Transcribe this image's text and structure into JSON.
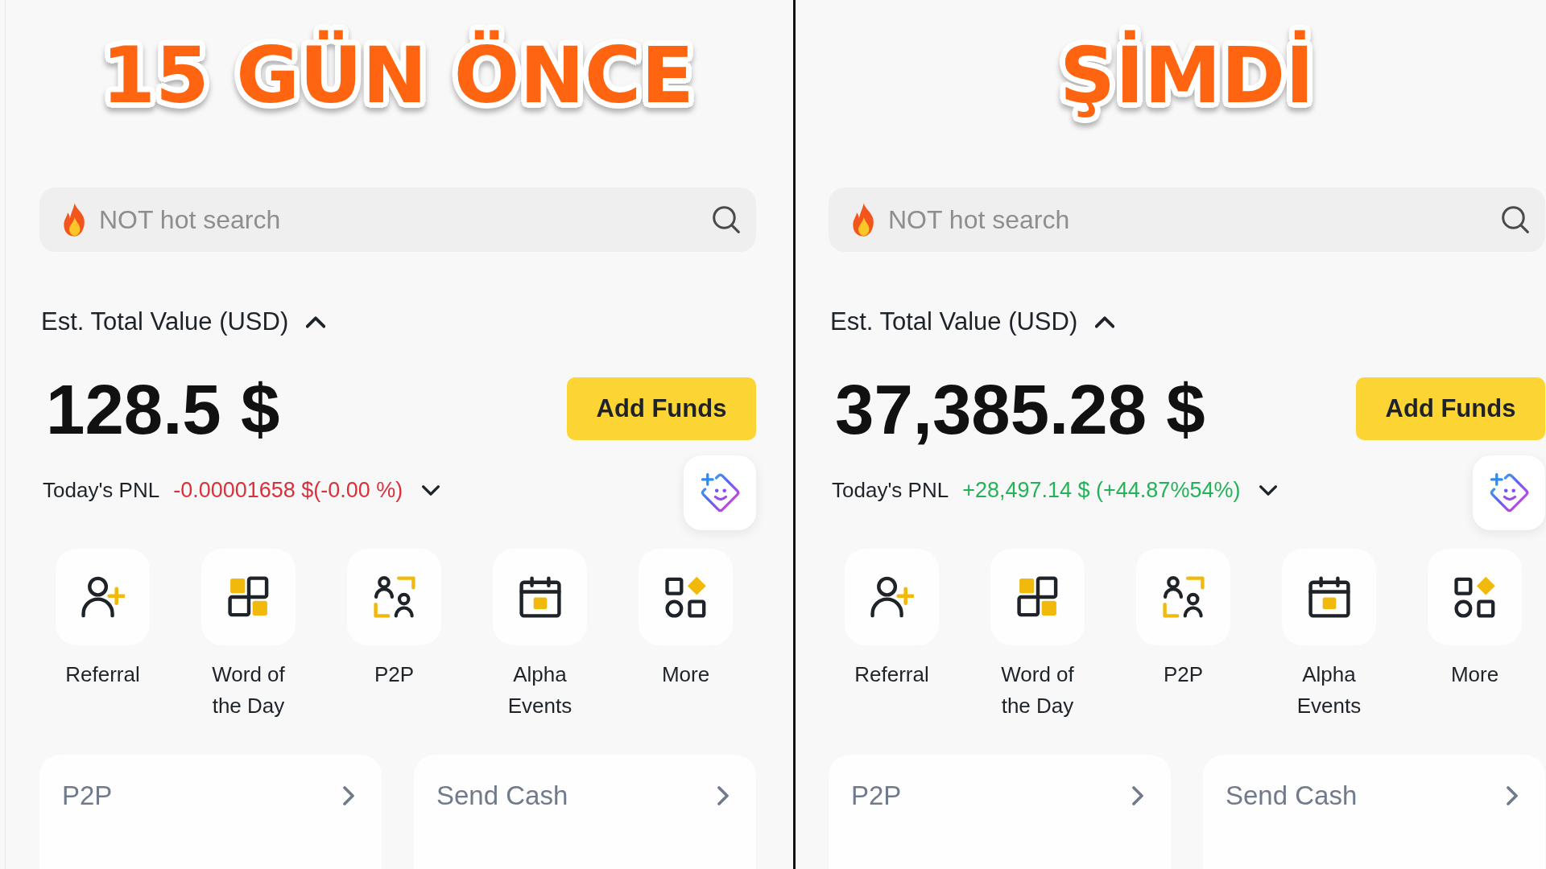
{
  "panels": [
    {
      "headline": "15 GÜN ÖNCE",
      "search": {
        "placeholder": "NOT hot search"
      },
      "balance": {
        "label": "Est. Total Value (USD)",
        "expanded": true,
        "value": "128.5 $",
        "button": "Add Funds"
      },
      "pnl": {
        "label": "Today's PNL",
        "value": "-0.00001658 $(-0.00 %)",
        "color": "#d9303a",
        "expanded": false
      },
      "shortcuts": [
        {
          "kind": "referral",
          "label": "Referral"
        },
        {
          "kind": "word",
          "label": "Word of the Day"
        },
        {
          "kind": "p2p",
          "label": "P2P"
        },
        {
          "kind": "calendar",
          "label": "Alpha Events"
        },
        {
          "kind": "more",
          "label": "More"
        }
      ],
      "cards": [
        "P2P",
        "Send Cash"
      ]
    },
    {
      "headline": "ŞİMDİ",
      "search": {
        "placeholder": "NOT hot search"
      },
      "balance": {
        "label": "Est. Total Value (USD)",
        "expanded": true,
        "value": "37,385.28 $",
        "button": "Add Funds"
      },
      "pnl": {
        "label": "Today's PNL",
        "value": "+28,497.14 $ (+44.87%54%)",
        "color": "#22b357",
        "expanded": false
      },
      "shortcuts": [
        {
          "kind": "referral",
          "label": "Referral"
        },
        {
          "kind": "word",
          "label": "Word of the Day"
        },
        {
          "kind": "p2p",
          "label": "P2P"
        },
        {
          "kind": "calendar",
          "label": "Alpha Events"
        },
        {
          "kind": "more",
          "label": "More"
        }
      ],
      "cards": [
        "P2P",
        "Send Cash"
      ]
    }
  ]
}
